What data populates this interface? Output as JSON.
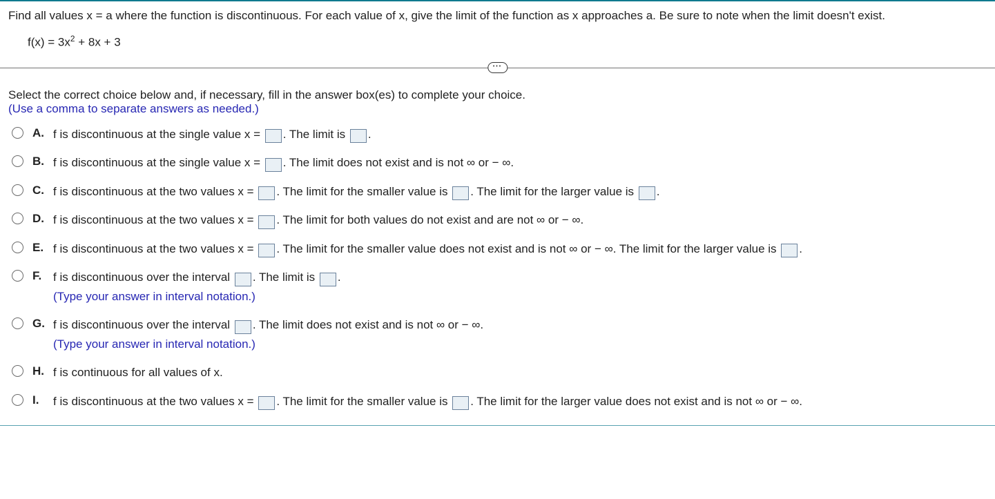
{
  "prompt": "Find all values x = a where the function is discontinuous. For each value of x, give the limit of the function as x approaches a. Be sure to note when the limit doesn't exist.",
  "equation_prefix": "f(x) = 3x",
  "equation_exp": "2",
  "equation_suffix": " + 8x + 3",
  "divider_dots": "•••",
  "instr1": "Select the correct choice below and, if necessary, fill in the answer box(es) to complete your choice.",
  "instr2": "(Use a comma to separate answers as needed.)",
  "opt": {
    "A": {
      "letter": "A.",
      "t1": "f is discontinuous at the single value x = ",
      "t2": ". The limit is ",
      "t3": "."
    },
    "B": {
      "letter": "B.",
      "t1": "f is discontinuous at the single value x = ",
      "t2": ". The limit does not exist and is not ∞ or − ∞."
    },
    "C": {
      "letter": "C.",
      "t1": "f is discontinuous at the two values x = ",
      "t2": ". The limit for the smaller value is ",
      "t3": ". The limit for the larger value is ",
      "t4": "."
    },
    "D": {
      "letter": "D.",
      "t1": "f is discontinuous at the two values x = ",
      "t2": ". The limit for both values do not exist and are not ∞ or − ∞."
    },
    "E": {
      "letter": "E.",
      "t1": "f is discontinuous at the two values x = ",
      "t2": ". The limit for the smaller value does not exist and is not ∞ or − ∞. The limit for the larger value is ",
      "t3": "."
    },
    "F": {
      "letter": "F.",
      "t1": "f is discontinuous over the interval ",
      "t2": ". The limit is ",
      "t3": ".",
      "note": "(Type your answer in interval notation.)"
    },
    "G": {
      "letter": "G.",
      "t1": "f is discontinuous over the interval ",
      "t2": ". The limit does not exist and is not ∞ or − ∞.",
      "note": "(Type your answer in interval notation.)"
    },
    "H": {
      "letter": "H.",
      "t1": "f is continuous for all values of x."
    },
    "I": {
      "letter": "I.",
      "t1": "f is discontinuous at the two values x = ",
      "t2": ". The limit for the smaller value is ",
      "t3": ". The limit for the larger value does not exist and is not ∞ or − ∞."
    }
  }
}
